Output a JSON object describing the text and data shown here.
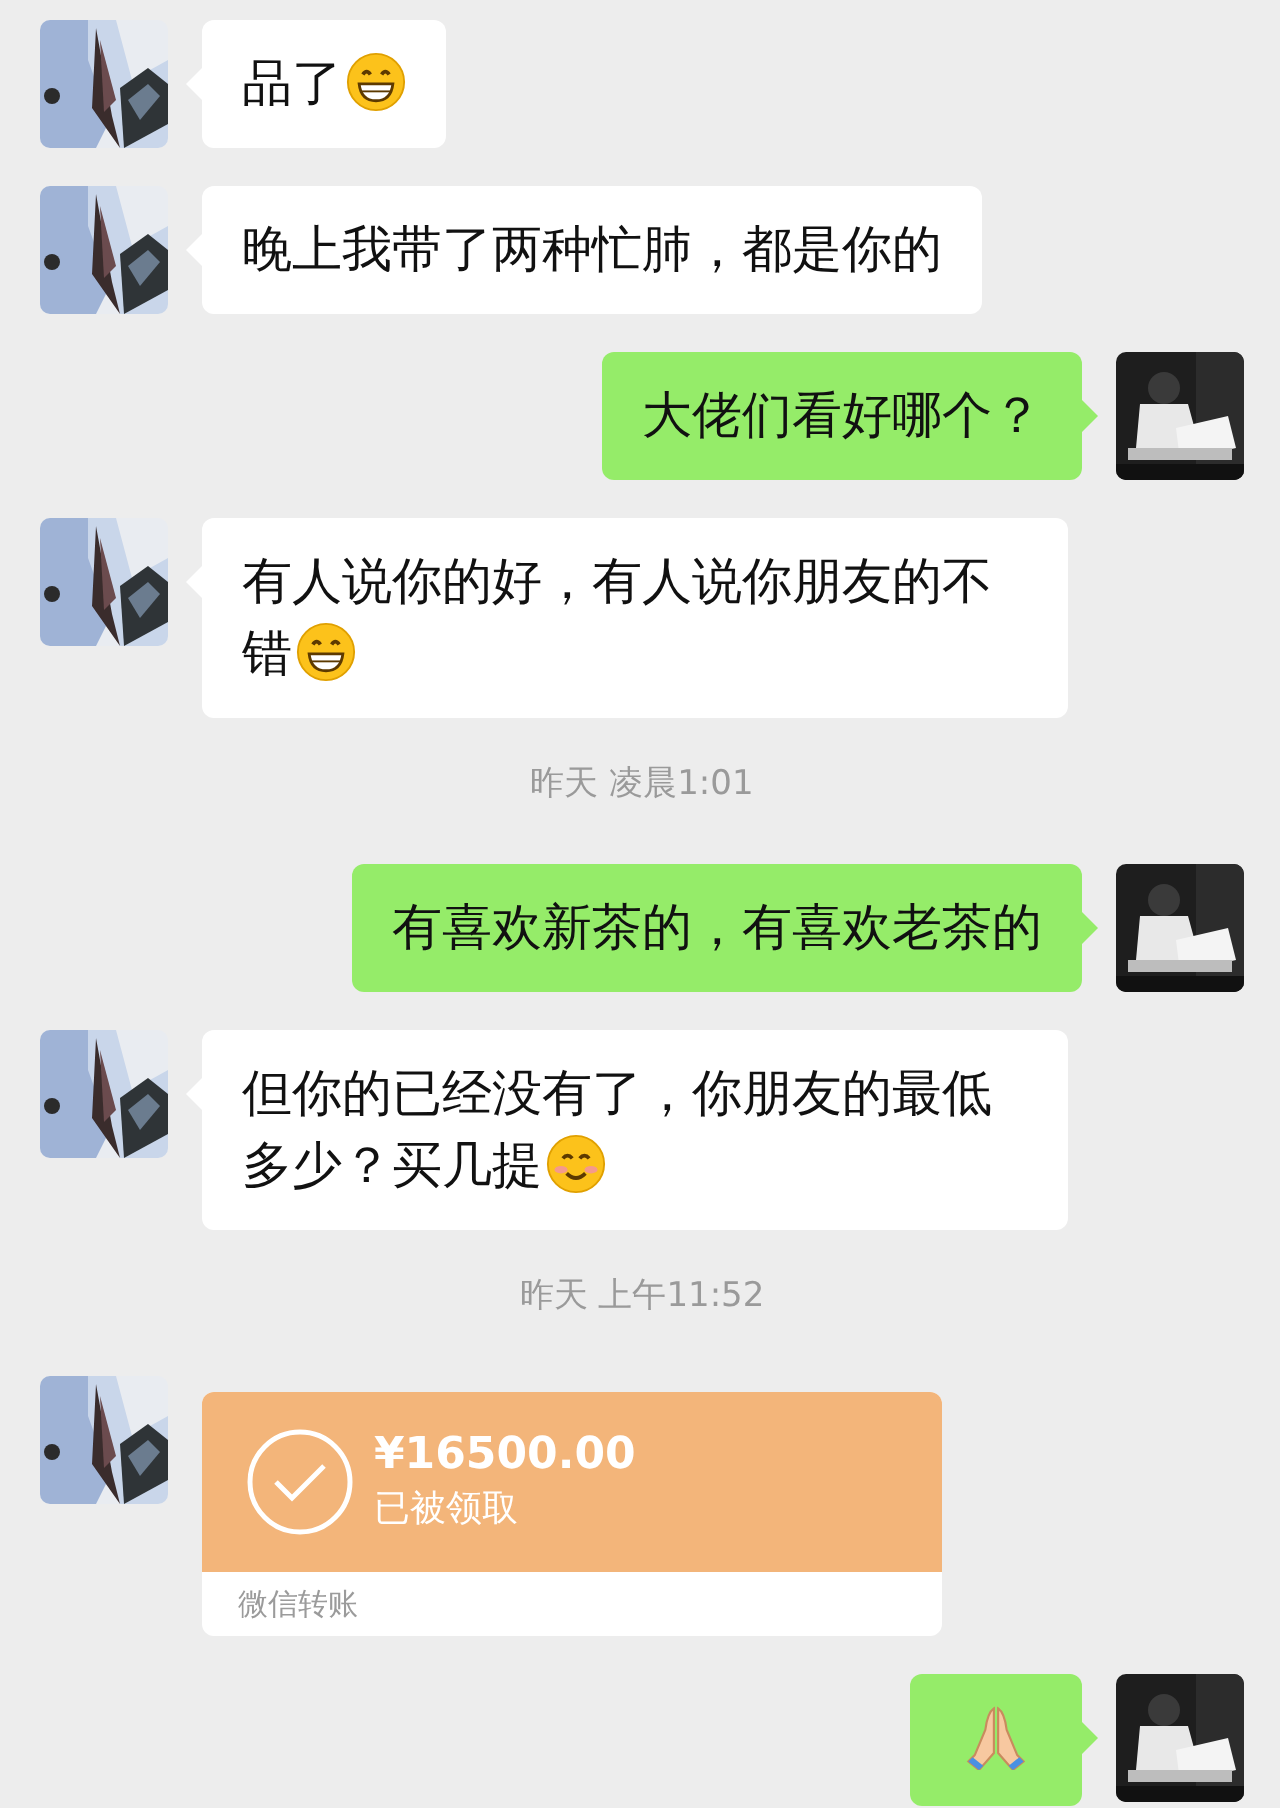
{
  "messages": [
    {
      "kind": "text",
      "outgoing": false,
      "text": "品了",
      "emoji": {
        "kind": "grin"
      }
    },
    {
      "kind": "text",
      "outgoing": false,
      "text": "晚上我带了两种忙肺，都是你的"
    },
    {
      "kind": "text",
      "outgoing": true,
      "text": "大佬们看好哪个？"
    },
    {
      "kind": "text",
      "outgoing": false,
      "text": "有人说你的好，有人说你朋友的不错",
      "emoji": {
        "kind": "grin"
      }
    },
    {
      "kind": "time",
      "text": "昨天 凌晨1:01"
    },
    {
      "kind": "text",
      "outgoing": true,
      "text": "有喜欢新茶的，有喜欢老茶的"
    },
    {
      "kind": "text",
      "outgoing": false,
      "text": "但你的已经没有了，你朋友的最低多少？买几提",
      "emoji": {
        "kind": "smile"
      }
    },
    {
      "kind": "time",
      "text": "昨天 上午11:52"
    },
    {
      "kind": "transfer",
      "outgoing": false,
      "amount": "¥16500.00",
      "status": "已被领取",
      "label": "微信转账"
    },
    {
      "kind": "text",
      "outgoing": true,
      "emoji": {
        "kind": "pray"
      }
    }
  ]
}
